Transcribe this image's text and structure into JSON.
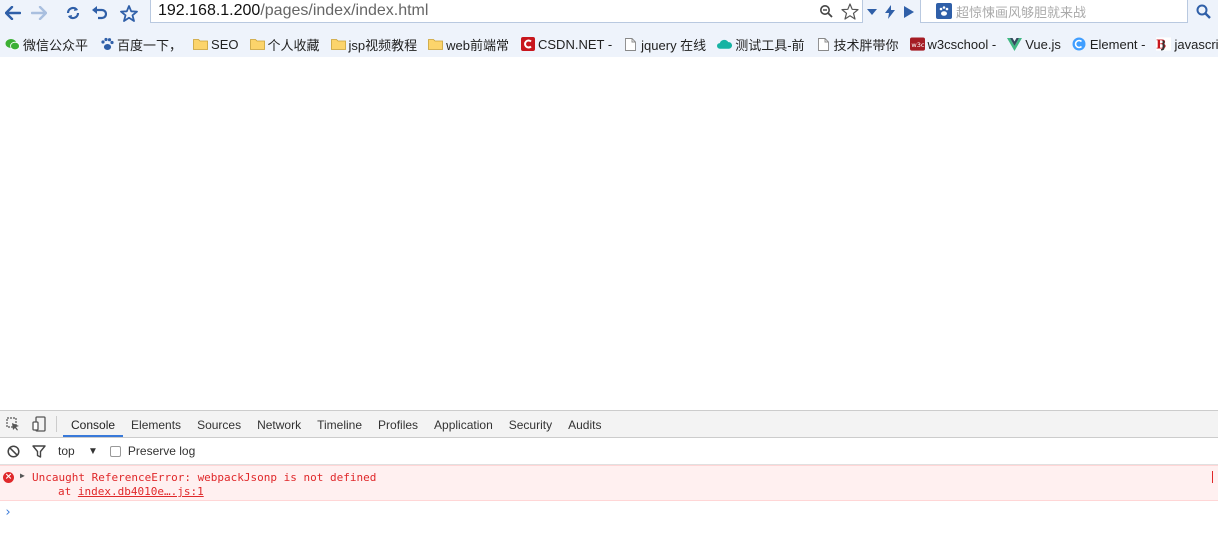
{
  "address_bar": {
    "host": "192.168.1.200",
    "path": "/pages/index/index.html"
  },
  "search_bar": {
    "placeholder": "超惊悚画风够胆就来战"
  },
  "bookmarks": [
    {
      "label": "微信公众平",
      "icon": "wechat-icon"
    },
    {
      "label": "百度一下，",
      "icon": "baidu-paw-icon"
    },
    {
      "label": "SEO",
      "icon": "folder-icon"
    },
    {
      "label": "个人收藏",
      "icon": "folder-icon"
    },
    {
      "label": "jsp视频教程",
      "icon": "folder-icon"
    },
    {
      "label": "web前端常",
      "icon": "folder-icon"
    },
    {
      "label": "CSDN.NET -",
      "icon": "csdn-icon"
    },
    {
      "label": "jquery 在线",
      "icon": "page-icon"
    },
    {
      "label": "测试工具-前",
      "icon": "cloud-icon"
    },
    {
      "label": "技术胖带你",
      "icon": "page-icon"
    },
    {
      "label": "w3cschool -",
      "icon": "w3c-icon"
    },
    {
      "label": "Vue.js",
      "icon": "vue-icon"
    },
    {
      "label": "Element -",
      "icon": "element-icon"
    },
    {
      "label": "javascript/jq",
      "icon": "bd-icon"
    }
  ],
  "devtools": {
    "tabs": [
      "Console",
      "Elements",
      "Sources",
      "Network",
      "Timeline",
      "Profiles",
      "Application",
      "Security",
      "Audits"
    ],
    "active_tab": "Console",
    "context": "top",
    "preserve_log_label": "Preserve log",
    "error": {
      "message": "Uncaught ReferenceError: webpackJsonp is not defined",
      "at_prefix": "at ",
      "location": "index.db4010e….js:1"
    },
    "prompt": "›"
  },
  "colors": {
    "chrome_bg": "#eef3fb",
    "accent": "#3879d9",
    "error_red": "#e0282a",
    "error_bg": "#fff0f0"
  }
}
